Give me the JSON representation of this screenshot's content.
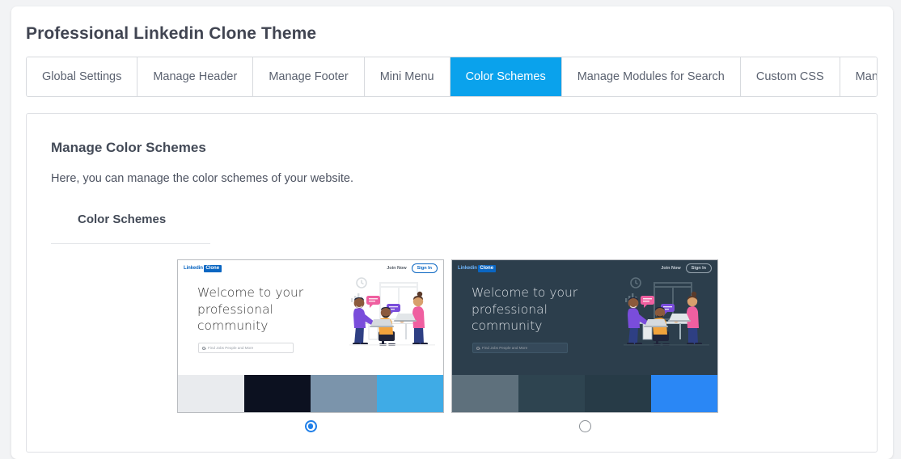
{
  "page": {
    "title": "Professional Linkedin Clone Theme"
  },
  "tabs": [
    {
      "label": "Global Settings",
      "active": false
    },
    {
      "label": "Manage Header",
      "active": false
    },
    {
      "label": "Manage Footer",
      "active": false
    },
    {
      "label": "Mini Menu",
      "active": false
    },
    {
      "label": "Color Schemes",
      "active": true
    },
    {
      "label": "Manage Modules for Search",
      "active": false
    },
    {
      "label": "Custom CSS",
      "active": false
    },
    {
      "label": "Manage Fonts",
      "active": false
    }
  ],
  "panel": {
    "title": "Manage Color Schemes",
    "description": "Here, you can manage the color schemes of your website.",
    "subsection_label": "Color Schemes"
  },
  "preview": {
    "logo_word": "Linkedin",
    "logo_badge": "Clone",
    "join_label": "Join Now",
    "signin_label": "Sign In",
    "heading": "Welcome to your professional community",
    "search_placeholder": "Find Jobs People and More"
  },
  "schemes": [
    {
      "name": "light-scheme",
      "selected": true,
      "theme": "light",
      "swatches": [
        "#e9ebee",
        "#0c1120",
        "#7b94ab",
        "#3fabe6"
      ]
    },
    {
      "name": "dark-scheme",
      "selected": false,
      "theme": "dark",
      "swatches": [
        "#5e707c",
        "#2e4450",
        "#273b47",
        "#2a87f5"
      ]
    }
  ],
  "colors": {
    "accent": "#0aa2ec",
    "radio_selected": "#1f7fe8",
    "brand_blue": "#0a66c2",
    "page_background": "#f2f3f5"
  }
}
